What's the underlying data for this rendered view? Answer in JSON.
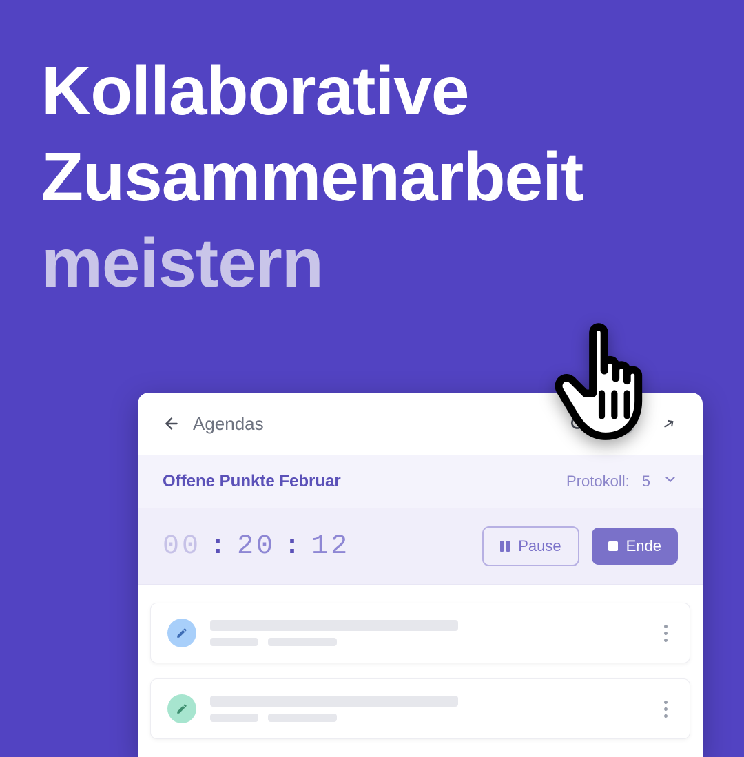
{
  "headline": {
    "line1": "Kollaborative",
    "line2": "Zusammenarbeit",
    "line3": "meistern"
  },
  "card": {
    "breadcrumb": "Agendas",
    "title": "Offene Punkte Februar",
    "protokoll_label": "Protokoll:",
    "protokoll_count": "5",
    "timer": {
      "hh": "00",
      "mm": "20",
      "ss": "12"
    },
    "pause_label": "Pause",
    "end_label": "Ende"
  },
  "icons": {
    "back": "arrow-left",
    "search": "search",
    "share": "share",
    "chevron": "chevron-down",
    "pencil": "pencil",
    "more": "more-vertical"
  },
  "colors": {
    "bg": "#5243C2",
    "accent": "#7A71C9"
  }
}
